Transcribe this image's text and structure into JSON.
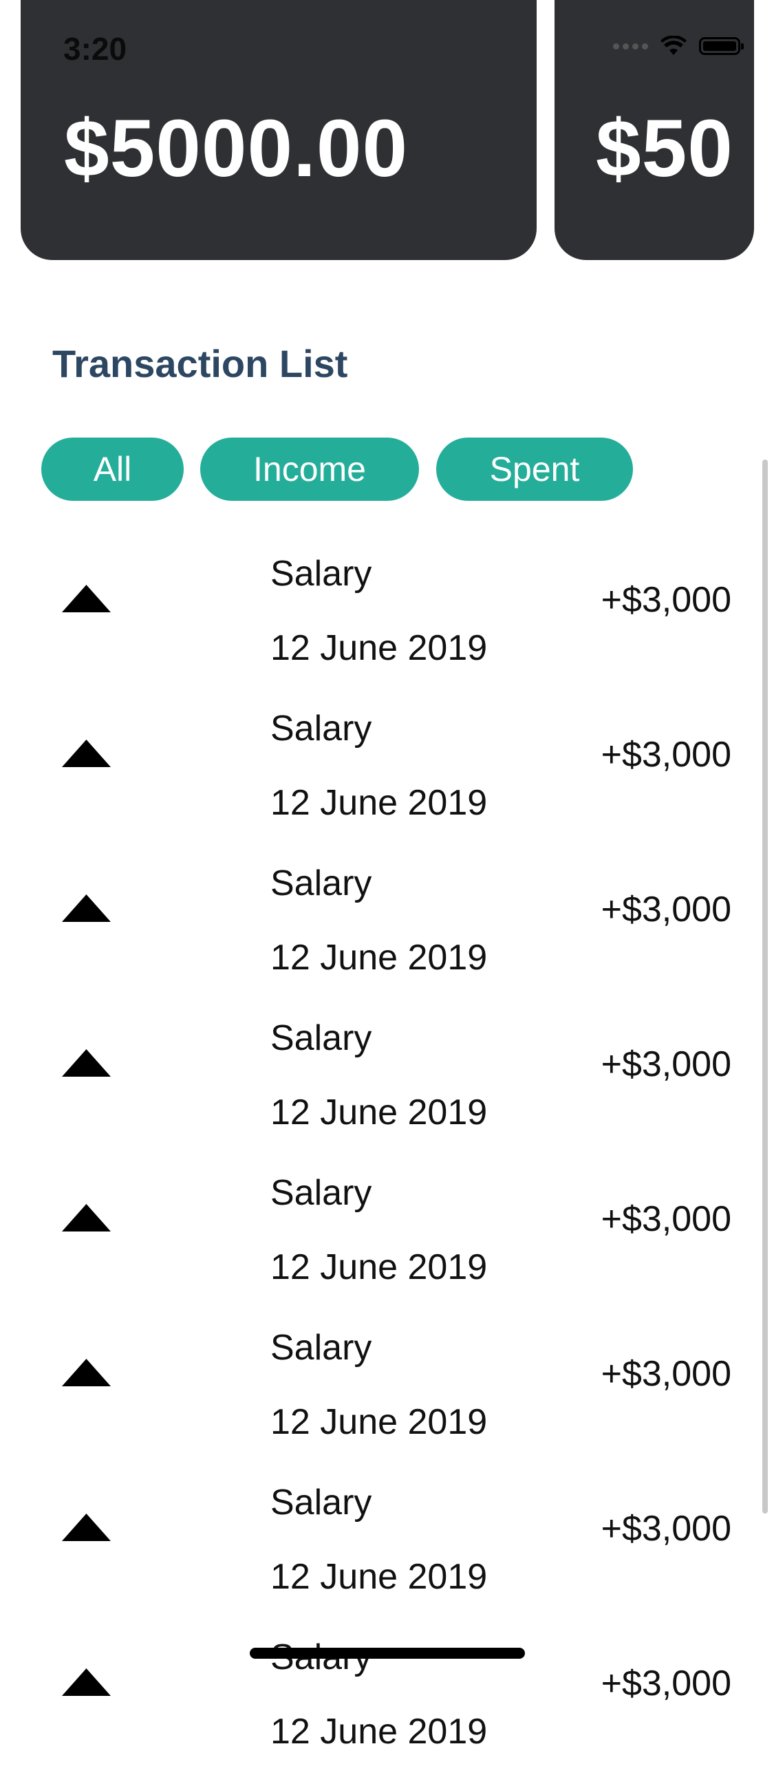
{
  "status": {
    "time": "3:20"
  },
  "cards": [
    {
      "balance": "$5000.00"
    },
    {
      "balance": "$50"
    }
  ],
  "section": {
    "title": "Transaction List"
  },
  "filters": [
    "All",
    "Income",
    "Spent"
  ],
  "transactions": [
    {
      "title": "Salary",
      "date": "12 June 2019",
      "amount": "+$3,000",
      "icon": "triangle-up-icon"
    },
    {
      "title": "Salary",
      "date": "12 June 2019",
      "amount": "+$3,000",
      "icon": "triangle-up-icon"
    },
    {
      "title": "Salary",
      "date": "12 June 2019",
      "amount": "+$3,000",
      "icon": "triangle-up-icon"
    },
    {
      "title": "Salary",
      "date": "12 June 2019",
      "amount": "+$3,000",
      "icon": "triangle-up-icon"
    },
    {
      "title": "Salary",
      "date": "12 June 2019",
      "amount": "+$3,000",
      "icon": "triangle-up-icon"
    },
    {
      "title": "Salary",
      "date": "12 June 2019",
      "amount": "+$3,000",
      "icon": "triangle-up-icon"
    },
    {
      "title": "Salary",
      "date": "12 June 2019",
      "amount": "+$3,000",
      "icon": "triangle-up-icon"
    },
    {
      "title": "Salary",
      "date": "12 June 2019",
      "amount": "+$3,000",
      "icon": "triangle-up-icon"
    }
  ],
  "colors": {
    "card": "#2f3033",
    "accent": "#24ae9a",
    "title": "#2d4763"
  }
}
